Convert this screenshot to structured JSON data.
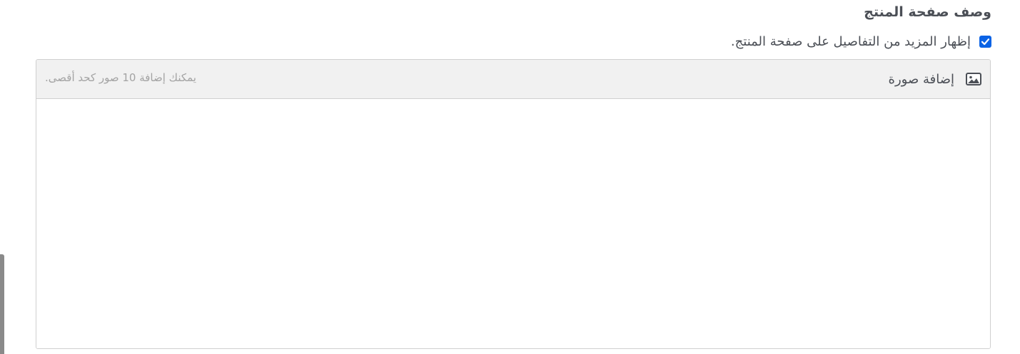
{
  "section": {
    "title": "وصف صفحة المنتج"
  },
  "option": {
    "label": "إظهار المزيد من التفاصيل على صفحة المنتج.",
    "checked": true,
    "accent_color": "#0b63e5"
  },
  "editor": {
    "toolbar": {
      "add_image_label": "إضافة صورة",
      "add_image_icon": "image-icon",
      "limit_hint": "يمكنك إضافة 10 صور كحد أقصى."
    },
    "body_text": ""
  }
}
